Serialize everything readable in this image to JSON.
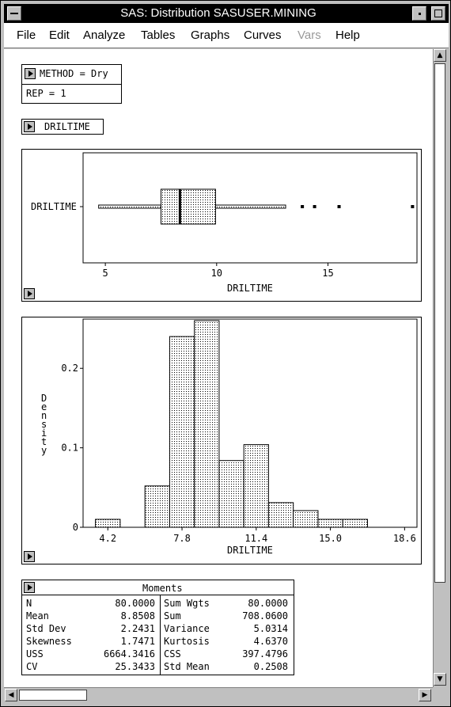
{
  "window": {
    "title": "SAS: Distribution SASUSER.MINING"
  },
  "menu": [
    {
      "label": "File",
      "enabled": true
    },
    {
      "label": "Edit",
      "enabled": true
    },
    {
      "label": "Analyze",
      "enabled": true
    },
    {
      "label": "Tables",
      "enabled": true
    },
    {
      "label": "Graphs",
      "enabled": true
    },
    {
      "label": "Curves",
      "enabled": true
    },
    {
      "label": "Vars",
      "enabled": false
    },
    {
      "label": "Help",
      "enabled": true
    }
  ],
  "groups": {
    "method": "METHOD = Dry",
    "rep": "REP = 1"
  },
  "variable": "DRILTIME",
  "boxplot": {
    "ylabel": "DRILTIME",
    "xlabel": "DRILTIME",
    "xticks": [
      5,
      10,
      15
    ],
    "xlim": [
      4.0,
      19.0
    ],
    "whisker_low": 4.7,
    "q1": 7.5,
    "median": 8.35,
    "q3": 9.95,
    "whisker_high": 13.1,
    "outliers": [
      13.85,
      14.4,
      15.5,
      18.8
    ]
  },
  "chart_data": {
    "type": "bar",
    "xlabel": "DRILTIME",
    "ylabel": "Density",
    "bin_width": 1.2,
    "bins_start": 3.6,
    "densities": [
      0.01,
      0.0,
      0.052,
      0.24,
      0.26,
      0.084,
      0.104,
      0.031,
      0.021,
      0.01,
      0.01,
      0.0,
      0.0,
      0.0,
      0.01
    ],
    "xticks": [
      4.2,
      7.8,
      11.4,
      15.0,
      18.6
    ],
    "xtick_labels": [
      "4.2",
      "7.8",
      "11.4",
      "15.0",
      "18.6"
    ],
    "yticks": [
      0,
      0.1,
      0.2
    ],
    "ytick_labels": [
      "0",
      "0.1",
      "0.2"
    ],
    "xlim": [
      3.0,
      19.2
    ],
    "ylim": [
      0,
      0.262
    ]
  },
  "moments": {
    "title": "Moments",
    "rows": [
      [
        "N",
        "80.0000",
        "Sum Wgts",
        "80.0000"
      ],
      [
        "Mean",
        "8.8508",
        "Sum",
        "708.0600"
      ],
      [
        "Std Dev",
        "2.2431",
        "Variance",
        "5.0314"
      ],
      [
        "Skewness",
        "1.7471",
        "Kurtosis",
        "4.6370"
      ],
      [
        "USS",
        "6664.3416",
        "CSS",
        "397.4796"
      ],
      [
        "CV",
        "25.3433",
        "Std Mean",
        "0.2508"
      ]
    ]
  }
}
